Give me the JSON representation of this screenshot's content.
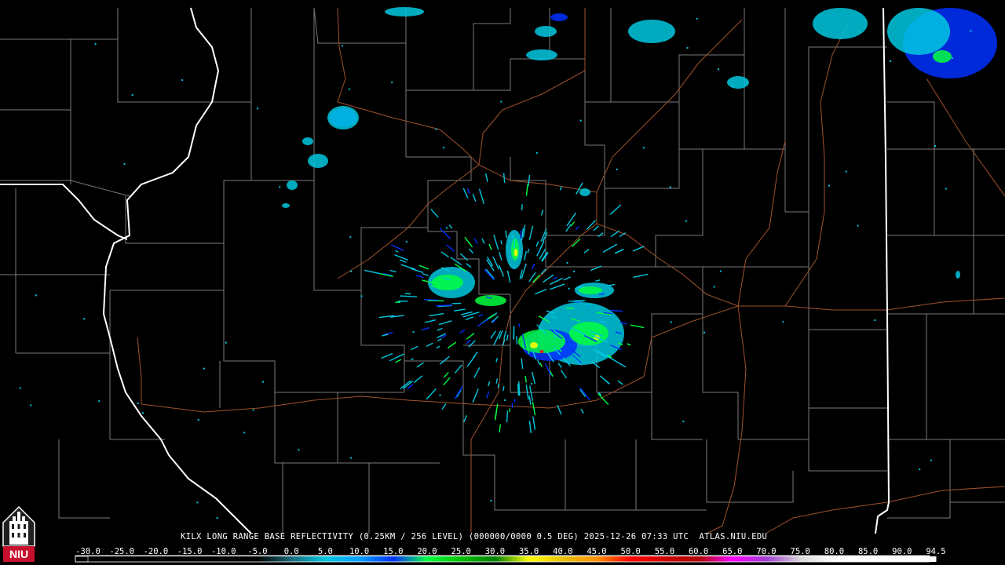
{
  "product_caption": "KILX LONG RANGE BASE REFLECTIVITY (0.25KM / 256 LEVEL) (000000/0000 0.5 DEG) 2025-12-26 07:33 UTC  ATLAS.NIU.EDU",
  "logo_text": "NIU",
  "legend": {
    "labels": [
      "-30.0",
      "-25.0",
      "-20.0",
      "-15.0",
      "-10.0",
      "-5.0",
      "0.0",
      "5.0",
      "10.0",
      "15.0",
      "20.0",
      "25.0",
      "30.0",
      "35.0",
      "40.0",
      "45.0",
      "50.0",
      "55.0",
      "60.0",
      "65.0",
      "70.0",
      "75.0",
      "80.0",
      "85.0",
      "90.0",
      "94.5"
    ],
    "colors": [
      "#000000",
      "#000000",
      "#000000",
      "#000000",
      "#000000",
      "#000000",
      "#1a6a7a",
      "#00c8e0",
      "#00a0ff",
      "#0030ff",
      "#00ff40",
      "#00c000",
      "#008000",
      "#ffff00",
      "#e8c000",
      "#ff9000",
      "#ff0000",
      "#d00000",
      "#b00000",
      "#ff00ff",
      "#a040d0",
      "#d8d8d8",
      "#ffffff",
      "#ffffff",
      "#ffffff",
      "#ffffff"
    ]
  },
  "colors": {
    "background": "#000000",
    "county_lines": "#7a7a7a",
    "state_lines": "#ffffff",
    "highways": "#a0522d",
    "echo_light_blue": "#00c8e0",
    "echo_blue": "#0030ff",
    "echo_green": "#00ff40",
    "echo_yellow": "#ffff00",
    "echo_red": "#ff0000"
  }
}
